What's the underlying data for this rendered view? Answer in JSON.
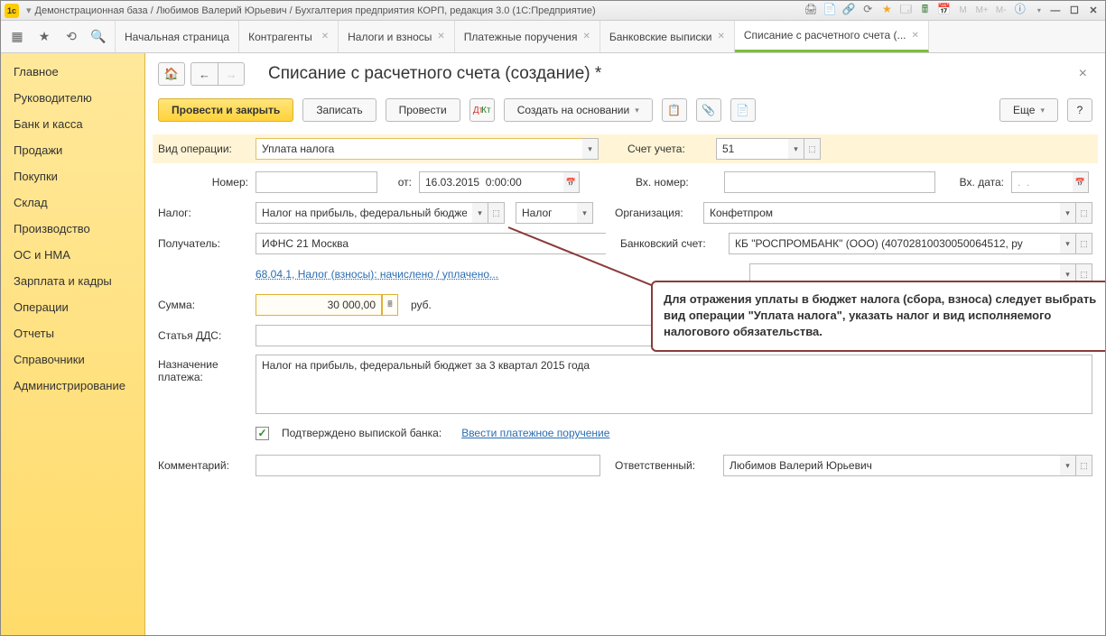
{
  "titlebar": {
    "title": "Демонстрационная база / Любимов Валерий Юрьевич / Бухгалтерия предприятия КОРП, редакция 3.0  (1С:Предприятие)",
    "logo": "1c"
  },
  "tabs": [
    {
      "label": "Начальная страница"
    },
    {
      "label": "Контрагенты"
    },
    {
      "label": "Налоги и взносы"
    },
    {
      "label": "Платежные поручения"
    },
    {
      "label": "Банковские выписки"
    },
    {
      "label": "Списание с расчетного счета (..."
    }
  ],
  "sidebar": {
    "items": [
      "Главное",
      "Руководителю",
      "Банк и касса",
      "Продажи",
      "Покупки",
      "Склад",
      "Производство",
      "ОС и НМА",
      "Зарплата и кадры",
      "Операции",
      "Отчеты",
      "Справочники",
      "Администрирование"
    ]
  },
  "page": {
    "title": "Списание с расчетного счета (создание) *"
  },
  "actions": {
    "primary": "Провести и закрыть",
    "write": "Записать",
    "post": "Провести",
    "create_based": "Создать на основании",
    "more": "Еще"
  },
  "labels": {
    "op_type": "Вид операции:",
    "account": "Счет учета:",
    "number": "Номер:",
    "from": "от:",
    "ext_number": "Вх. номер:",
    "ext_date": "Вх. дата:",
    "tax": "Налог:",
    "tax2": "Налог",
    "org": "Организация:",
    "recipient": "Получатель:",
    "bank_acc": "Банковский счет:",
    "sum": "Сумма:",
    "currency": "руб.",
    "dds": "Статья ДДС:",
    "purpose": "Назначение платежа:",
    "confirmed": "Подтверждено выпиской банка:",
    "enter_pp": "Ввести платежное поручение",
    "comment": "Комментарий:",
    "responsible": "Ответственный:",
    "link_6804": "68.04.1, Налог (взносы): начислено / уплачено..."
  },
  "values": {
    "op_type": "Уплата налога",
    "account": "51",
    "date": "16.03.2015  0:00:00",
    "ext_date": ".  .",
    "tax": "Налог на прибыль, федеральный бюдже",
    "org": "Конфетпром",
    "recipient": "ИФНС 21 Москва",
    "bank_acc": "КБ \"РОСПРОМБАНК\" (ООО) (40702810030050064512, ру",
    "sum": "30 000,00",
    "purpose": "Налог на прибыль, федеральный бюджет за 3 квартал 2015 года",
    "responsible": "Любимов Валерий Юрьевич"
  },
  "callout": {
    "text": "Для отражения уплаты в бюджет налога (сбора, взноса) следует выбрать вид операции \"Уплата налога\", указать налог и вид исполняемого налогового обязательства."
  }
}
